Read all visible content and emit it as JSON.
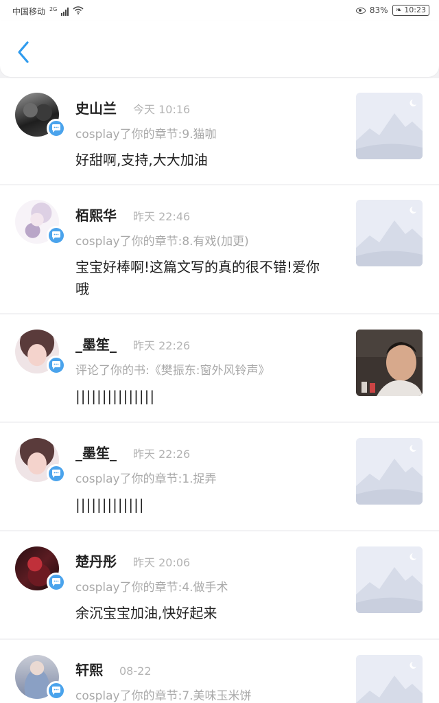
{
  "status": {
    "carrier": "中国移动",
    "network": "2G",
    "battery": "83%",
    "time": "10:23"
  },
  "header": {
    "back_label": ""
  },
  "items": [
    {
      "name": "史山兰",
      "time": "今天 10:16",
      "action": "cosplay了你的章节:9.猫咖",
      "comment": "好甜啊,支持,大大加油",
      "thumb": "placeholder"
    },
    {
      "name": "栢熙华",
      "time": "昨天 22:46",
      "action": "cosplay了你的章节:8.有戏(加更)",
      "comment": "宝宝好棒啊!这篇文写的真的很不错!爱你哦",
      "thumb": "placeholder"
    },
    {
      "name": "_墨笙_",
      "time": "昨天 22:26",
      "action": "评论了你的书:《樊振东:窗外风铃声》",
      "comment": "|||||||||||||||",
      "thumb": "photo"
    },
    {
      "name": "_墨笙_",
      "time": "昨天 22:26",
      "action": "cosplay了你的章节:1.捉弄",
      "comment": "|||||||||||||",
      "thumb": "placeholder"
    },
    {
      "name": "楚丹彤",
      "time": "昨天 20:06",
      "action": "cosplay了你的章节:4.做手术",
      "comment": "余沉宝宝加油,快好起来",
      "thumb": "placeholder"
    },
    {
      "name": "轩熙",
      "time": "08-22",
      "action": "cosplay了你的章节:7.美味玉米饼",
      "comment": "",
      "thumb": "placeholder"
    }
  ],
  "colors": {
    "accent": "#4aa3ec",
    "back_arrow": "#2f9bee",
    "placeholder_bg": "#e9ecf5"
  }
}
